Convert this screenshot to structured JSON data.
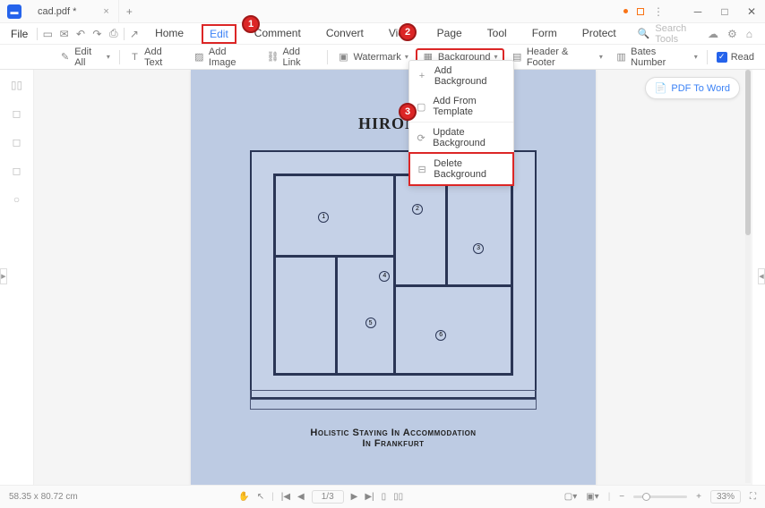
{
  "titlebar": {
    "filename": "cad.pdf *"
  },
  "menubar": {
    "file": "File"
  },
  "menu_tabs": [
    "Home",
    "Edit",
    "Comment",
    "Convert",
    "View",
    "Page",
    "Tool",
    "Form",
    "Protect"
  ],
  "search": {
    "placeholder": "Search Tools"
  },
  "toolbar": {
    "edit_all": "Edit All",
    "add_text": "Add Text",
    "add_image": "Add Image",
    "add_link": "Add Link",
    "watermark": "Watermark",
    "background": "Background",
    "header_footer": "Header & Footer",
    "bates": "Bates Number",
    "read": "Read"
  },
  "dropdown": {
    "add_bg": "Add Background",
    "add_template": "Add From Template",
    "update_bg": "Update Background",
    "delete_bg": "Delete Background"
  },
  "pdf_to_word": "PDF To Word",
  "document": {
    "title": "HIROMI",
    "subtitle1": "Holistic Staying In Accommodation",
    "subtitle2": "In Frankfurt"
  },
  "statusbar": {
    "dimensions": "58.35 x 80.72 cm",
    "page": "1/3",
    "zoom": "33%"
  },
  "badges": {
    "b1": "1",
    "b2": "2",
    "b3": "3"
  }
}
